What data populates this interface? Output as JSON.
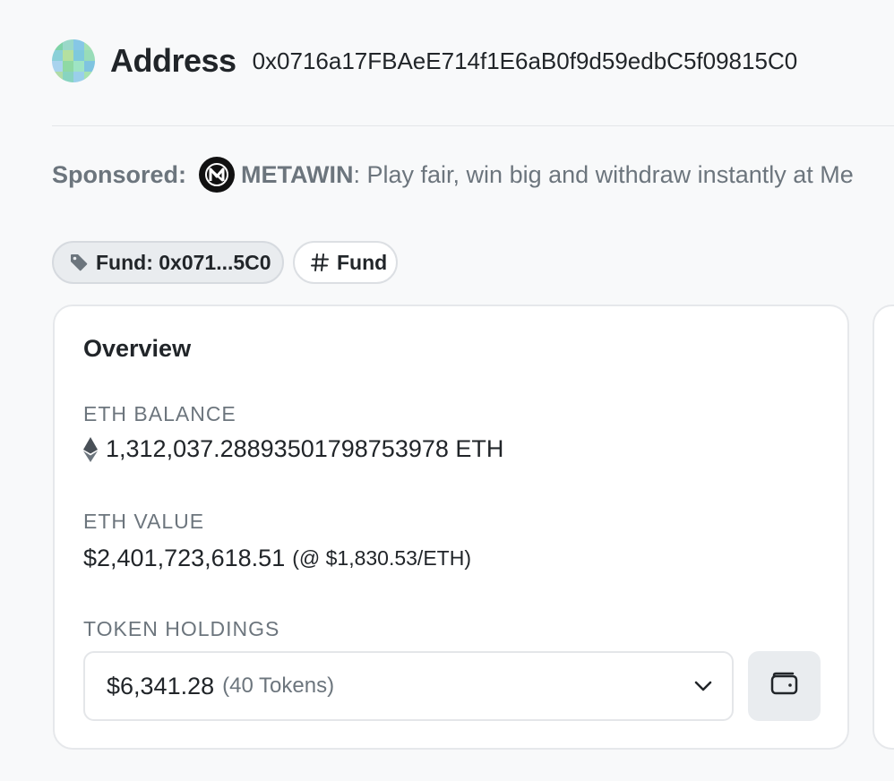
{
  "header": {
    "title": "Address",
    "address": "0x0716a17FBAeE714f1E6aB0f9d59edbC5f09815C0",
    "avatar_colors": [
      "#7fd3a8",
      "#9ad8c9",
      "#86c7e6",
      "#a3e0b4",
      "#8ad0d8",
      "#b4e0a0",
      "#7ec9dc",
      "#98dcb8",
      "#a9d3ee",
      "#8fd9a4",
      "#9ee4c4",
      "#7fc4e0",
      "#b0dca8",
      "#88d4c0",
      "#9acfea",
      "#a6e2b0"
    ]
  },
  "sponsored": {
    "label": "Sponsored:",
    "sponsor_name": "METAWIN",
    "message": ": Play fair, win big and withdraw instantly at Me"
  },
  "tags": [
    {
      "label": "Fund: 0x071...5C0",
      "icon": "tag-icon"
    },
    {
      "label": "Fund",
      "icon": "hashtag-icon"
    }
  ],
  "overview": {
    "title": "Overview",
    "eth_balance_label": "ETH BALANCE",
    "eth_balance_value": "1,312,037.28893501798753978 ETH",
    "eth_value_label": "ETH VALUE",
    "eth_value_value": "$2,401,723,618.51",
    "eth_value_rate": "(@ $1,830.53/ETH)",
    "token_holdings_label": "TOKEN HOLDINGS",
    "token_holdings_amount": "$6,341.28",
    "token_holdings_count": "(40 Tokens)"
  }
}
